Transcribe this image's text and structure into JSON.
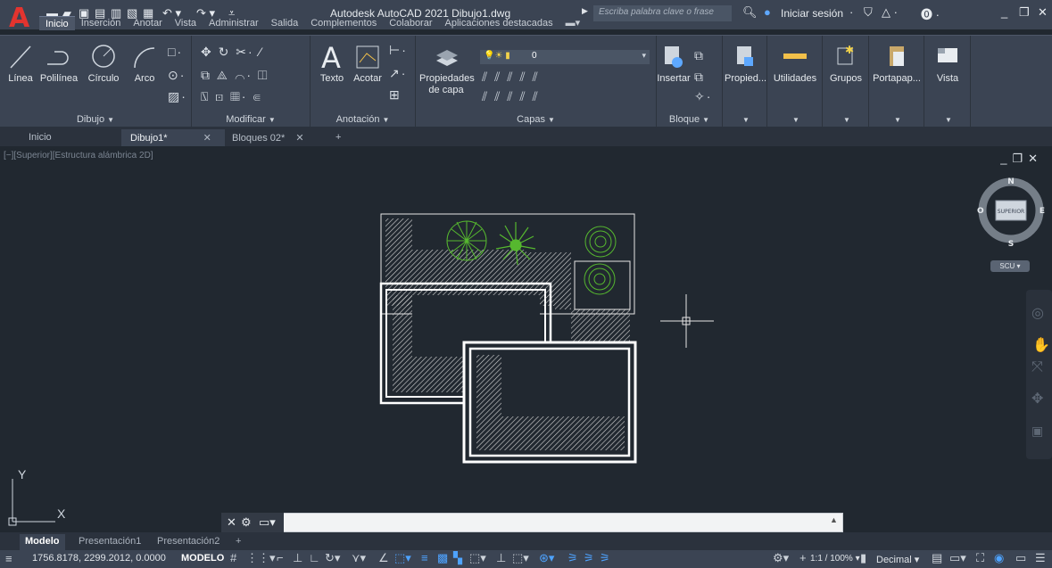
{
  "app": {
    "title": "Autodesk AutoCAD 2021   Dibujo1.dwg",
    "search_placeholder": "Escriba palabra clave o frase",
    "signin": "Iniciar sesión",
    "logo": "A"
  },
  "ribbon_tabs": [
    "Inicio",
    "Inserción",
    "Anotar",
    "Vista",
    "Administrar",
    "Salida",
    "Complementos",
    "Colaborar",
    "Aplicaciones destacadas"
  ],
  "panels": {
    "dibujo": {
      "title": "Dibujo",
      "linea": "Línea",
      "polilinea": "Polilínea",
      "circulo": "Círculo",
      "arco": "Arco"
    },
    "modificar": {
      "title": "Modificar"
    },
    "anotacion": {
      "title": "Anotación",
      "texto": "Texto",
      "acotar": "Acotar"
    },
    "capas": {
      "title": "Capas",
      "propiedades_1": "Propiedades",
      "propiedades_2": "de capa",
      "layer_value": "0"
    },
    "bloque": {
      "title": "Bloque",
      "insertar": "Insertar"
    },
    "extra": [
      "Propied...",
      "Utilidades",
      "Grupos",
      "Portapap...",
      "Vista"
    ]
  },
  "doc_tabs": [
    {
      "label": "Inicio"
    },
    {
      "label": "Dibujo1*",
      "close": "✕"
    },
    {
      "label": "Bloques 02*",
      "close": "✕"
    }
  ],
  "doc_tab_add": "+",
  "viewport": {
    "label": "[−][Superior][Estructura alámbrica 2D]",
    "viewcube": {
      "n": "N",
      "s": "S",
      "e": "E",
      "o": "O",
      "face": "SUPERIOR"
    },
    "ucs_label": "SCU",
    "axis_x": "X",
    "axis_y": "Y"
  },
  "cmdline": {
    "value": ""
  },
  "layout_tabs": [
    "Modelo",
    "Presentación1",
    "Presentación2"
  ],
  "layout_tab_add": "+",
  "status": {
    "coords": "1756.8178, 2299.2012, 0.0000",
    "mode": "MODELO",
    "scale": "1:1 / 100%",
    "units": "Decimal"
  },
  "colors": {
    "brand": "#e3342f",
    "accent": "#4ea3ff",
    "tree_green": "#56b82f",
    "hatch": "#cfcfcf"
  },
  "icons": [
    "new-icon",
    "open-icon",
    "save-icon",
    "saveas-icon",
    "print-icon",
    "undo-icon",
    "redo-icon",
    "search-icon",
    "user-icon",
    "cart-icon",
    "help-icon",
    "minimize-icon",
    "restore-icon",
    "close-icon",
    "crosshair-icon",
    "grid-icon",
    "snap-icon",
    "ortho-icon",
    "polar-icon",
    "osnap-icon",
    "annotation-icon",
    "workspace-icon",
    "menu-icon"
  ]
}
